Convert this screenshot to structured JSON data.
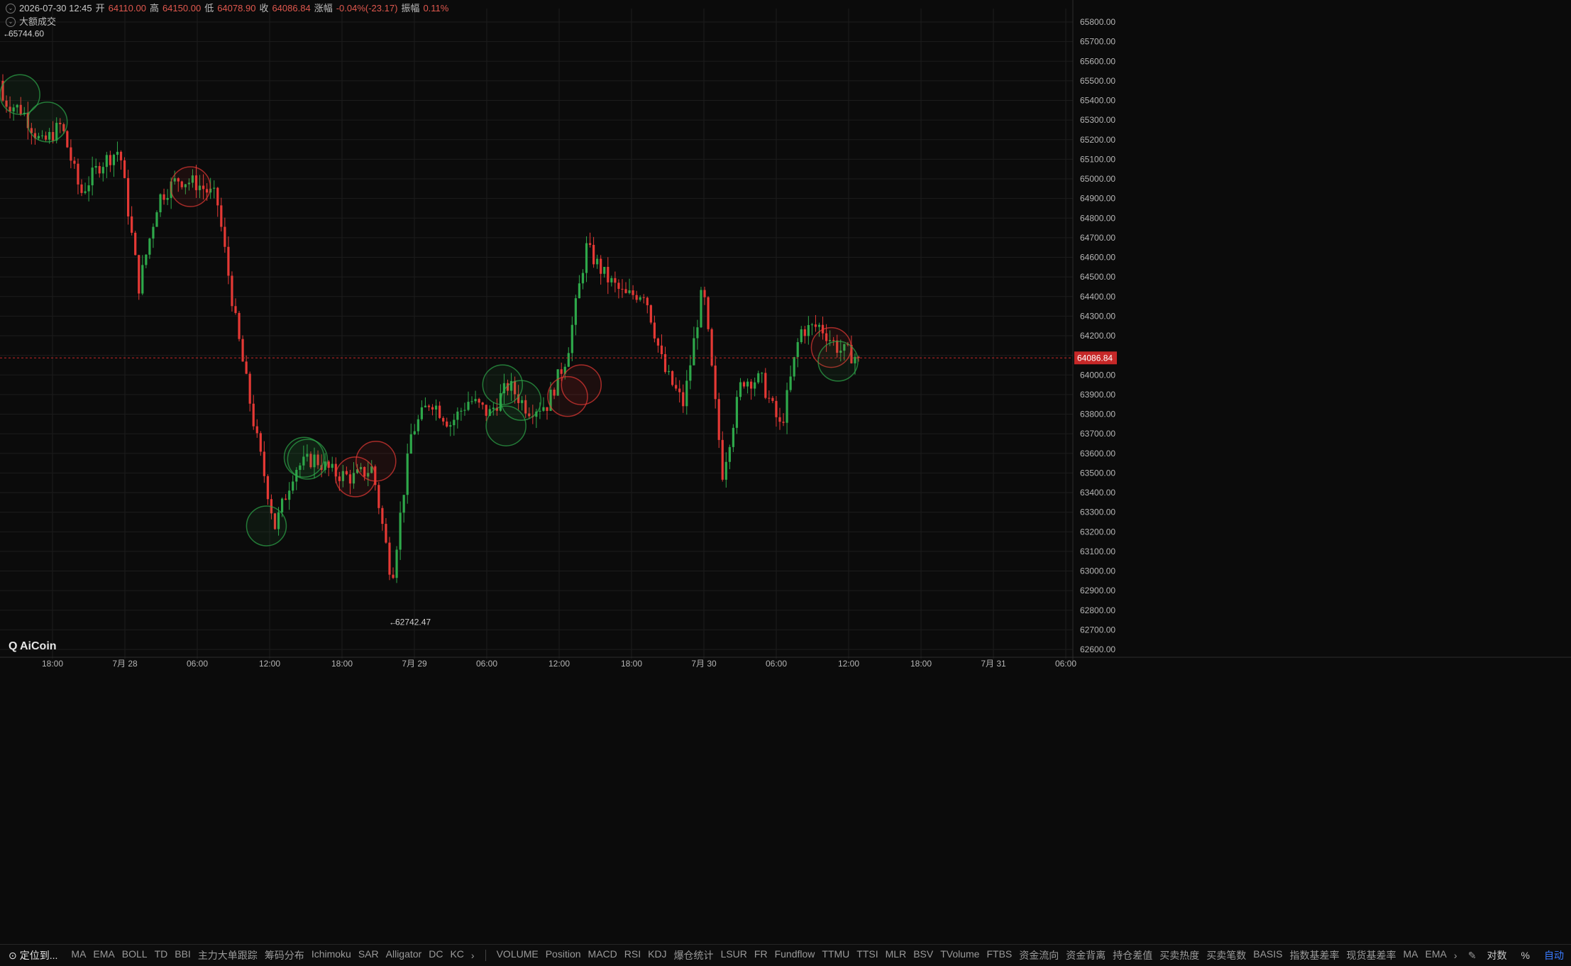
{
  "header": {
    "datetime": "2026-07-30 12:45",
    "open_label": "开",
    "open": "64110.00",
    "high_label": "高",
    "high": "64150.00",
    "low_label": "低",
    "low": "64078.90",
    "close_label": "收",
    "close": "64086.84",
    "change_label": "涨幅",
    "change": "-0.04%(-23.17)",
    "amp_label": "振幅",
    "amp": "0.11%",
    "big_trades_label": "大额成交"
  },
  "colors": {
    "up": "#2ea84a",
    "down": "#e53935",
    "background": "#0b0b0b",
    "price_line": "#c62828"
  },
  "chart_data": {
    "type": "candlestick",
    "price_axis_ticks": [
      "65800.00",
      "65700.00",
      "65600.00",
      "65500.00",
      "65400.00",
      "65300.00",
      "65200.00",
      "65100.00",
      "65000.00",
      "64900.00",
      "64800.00",
      "64700.00",
      "64600.00",
      "64500.00",
      "64400.00",
      "64300.00",
      "64200.00",
      "64100.00",
      "64000.00",
      "63900.00",
      "63800.00",
      "63700.00",
      "63600.00",
      "63500.00",
      "63400.00",
      "63300.00",
      "63200.00",
      "63100.00",
      "63000.00",
      "62900.00",
      "62800.00",
      "62700.00",
      "62600.00"
    ],
    "ylim": [
      62580,
      65860
    ],
    "time_axis_labels": [
      "18:00",
      "7月 28",
      "06:00",
      "12:00",
      "18:00",
      "7月 29",
      "06:00",
      "12:00",
      "18:00",
      "7月 30",
      "06:00",
      "12:00",
      "18:00",
      "7月 31",
      "06:00"
    ],
    "current_price": "64086.84",
    "current_price_value": 64086.84,
    "high_marker": "65744.60",
    "high_marker_value": 65744.6,
    "low_marker": "62742.47",
    "low_marker_value": 62742.47,
    "path_points": [
      [
        65300,
        65500
      ],
      [
        65450,
        65250
      ],
      [
        65100,
        65250
      ],
      [
        65350,
        65200
      ],
      [
        65000,
        64850
      ],
      [
        65100,
        65050
      ],
      [
        65050,
        65250
      ],
      [
        64500,
        64400
      ],
      [
        64850,
        64950
      ],
      [
        64950,
        65050
      ],
      [
        64900,
        65050
      ],
      [
        64950,
        64850
      ],
      [
        64650,
        63850
      ],
      [
        63750,
        63650
      ],
      [
        63250,
        63200
      ],
      [
        63500,
        63550
      ],
      [
        63550,
        63600
      ],
      [
        63450,
        63550
      ],
      [
        63500,
        63450
      ],
      [
        63550,
        63500
      ],
      [
        63050,
        62870
      ],
      [
        63600,
        63800
      ],
      [
        63900,
        63850
      ],
      [
        63700,
        63800
      ],
      [
        63800,
        63950
      ],
      [
        63950,
        63650
      ],
      [
        64000,
        63900
      ],
      [
        63700,
        63950
      ],
      [
        63900,
        63800
      ],
      [
        64050,
        64150
      ],
      [
        64600,
        64700
      ],
      [
        64550,
        64450
      ],
      [
        64300,
        64500
      ],
      [
        64700,
        64150
      ],
      [
        64050,
        64000
      ],
      [
        63750,
        63950
      ],
      [
        64600,
        64300
      ],
      [
        63600,
        63400
      ],
      [
        63900,
        64050
      ],
      [
        63950,
        64000
      ],
      [
        63700,
        63750
      ],
      [
        64100,
        64350
      ],
      [
        64300,
        64200
      ],
      [
        64150,
        64110
      ],
      [
        64086.84,
        64086.84
      ]
    ],
    "bubbles": [
      {
        "color": "green",
        "t": 0.025,
        "p": 65430
      },
      {
        "color": "green",
        "t": 0.065,
        "p": 65290
      },
      {
        "color": "red",
        "t": 0.274,
        "p": 64960
      },
      {
        "color": "green",
        "t": 0.385,
        "p": 63230
      },
      {
        "color": "green",
        "t": 0.44,
        "p": 63580
      },
      {
        "color": "green",
        "t": 0.445,
        "p": 63570
      },
      {
        "color": "red",
        "t": 0.515,
        "p": 63480
      },
      {
        "color": "red",
        "t": 0.545,
        "p": 63560
      },
      {
        "color": "green",
        "t": 0.73,
        "p": 63950
      },
      {
        "color": "green",
        "t": 0.735,
        "p": 63740
      },
      {
        "color": "green",
        "t": 0.757,
        "p": 63870
      },
      {
        "color": "red",
        "t": 0.825,
        "p": 63890
      },
      {
        "color": "red",
        "t": 0.845,
        "p": 63950
      },
      {
        "color": "red",
        "t": 1.21,
        "p": 64140
      },
      {
        "color": "green",
        "t": 1.22,
        "p": 64070
      }
    ]
  },
  "bottom": {
    "locate_label": "定位到...",
    "indicators_main": [
      "MA",
      "EMA",
      "BOLL",
      "TD",
      "BBI",
      "主力大单跟踪",
      "筹码分布",
      "Ichimoku",
      "SAR",
      "Alligator",
      "DC",
      "KC"
    ],
    "more_arrow": "›",
    "indicators_sub": [
      "VOLUME",
      "Position",
      "MACD",
      "RSI",
      "KDJ",
      "爆仓统计",
      "LSUR",
      "FR",
      "Fundflow",
      "TTMU",
      "TTSI",
      "MLR",
      "BSV",
      "TVolume",
      "FTBS",
      "资金流向",
      "资金背离",
      "持仓差值",
      "买卖热度",
      "买卖笔数",
      "BASIS",
      "指数基差率",
      "现货基差率",
      "MA",
      "EMA"
    ],
    "sub_more_arrow": "›",
    "scale_log": "对数",
    "scale_pct": "%",
    "scale_auto": "自动"
  },
  "logo": {
    "text": "AiCoin"
  }
}
